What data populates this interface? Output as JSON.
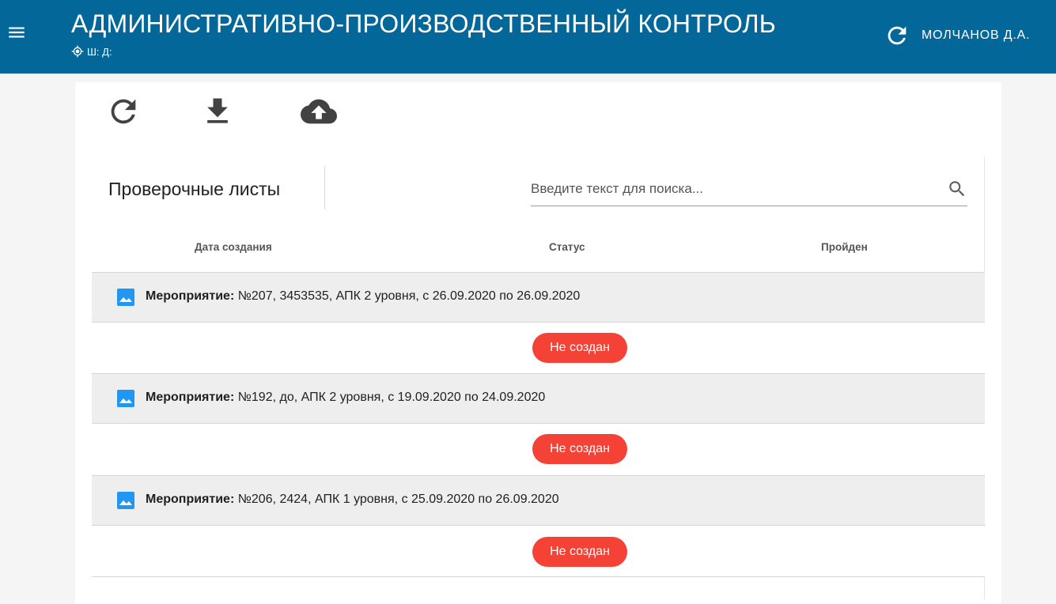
{
  "header": {
    "title": "АДМИНИСТРАТИВНО-ПРОИЗВОДСТВЕННЫЙ КОНТРОЛЬ",
    "subtitle": "Ш: Д:",
    "user": "МОЛЧАНОВ Д.А."
  },
  "colors": {
    "appbar": "#03679a",
    "badge": "#f44336",
    "group_bg": "#eeeeee"
  },
  "panel": {
    "title": "Проверочные листы",
    "search_placeholder": "Введите текст для поиска..."
  },
  "columns": [
    "Дата создания",
    "Статус",
    "Пройден"
  ],
  "events": [
    {
      "prefix": "Мероприятие:",
      "text": " №207, 3453535, АПК 2 уровня, с 26.09.2020 по 26.09.2020",
      "status": "Не создан"
    },
    {
      "prefix": "Мероприятие:",
      "text": " №192, до, АПК 2 уровня, с 19.09.2020 по 24.09.2020",
      "status": "Не создан"
    },
    {
      "prefix": "Мероприятие:",
      "text": " №206, 2424, АПК 1 уровня, с 25.09.2020 по 26.09.2020",
      "status": "Не создан"
    }
  ],
  "icons": {
    "menu": "menu-icon",
    "locate": "crosshair-icon",
    "refresh": "refresh-icon",
    "download": "download-icon",
    "upload": "cloud-upload-icon",
    "search": "search-icon",
    "event": "image-icon"
  }
}
